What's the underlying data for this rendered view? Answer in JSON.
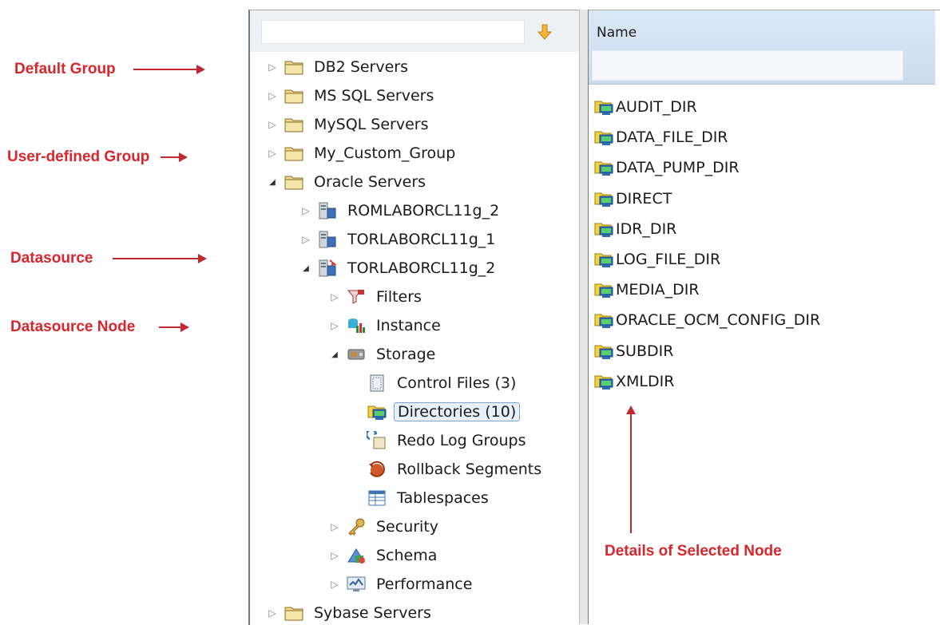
{
  "callouts": {
    "default_group": "Default Group",
    "user_defined_group": "User-defined Group",
    "datasource": "Datasource",
    "datasource_node": "Datasource Node",
    "details_of_selected_node": "Details of Selected Node"
  },
  "tree": {
    "search_placeholder": "",
    "items": [
      {
        "label": "DB2 Servers",
        "icon": "folder-icon"
      },
      {
        "label": "MS SQL Servers",
        "icon": "folder-icon"
      },
      {
        "label": "MySQL Servers",
        "icon": "folder-icon"
      },
      {
        "label": "My_Custom_Group",
        "icon": "folder-icon"
      },
      {
        "label": "Oracle Servers",
        "icon": "folder-icon"
      },
      {
        "label": "ROMLABORCL11g_2",
        "icon": "database-server-icon"
      },
      {
        "label": "TORLABORCL11g_1",
        "icon": "database-server-icon"
      },
      {
        "label": "TORLABORCL11g_2",
        "icon": "database-server-connected-icon"
      },
      {
        "label": "Filters",
        "icon": "filter-funnel-icon"
      },
      {
        "label": "Instance",
        "icon": "instance-icon"
      },
      {
        "label": "Storage",
        "icon": "storage-icon"
      },
      {
        "label": "Control Files (3)",
        "icon": "control-files-icon"
      },
      {
        "label": "Directories (10)",
        "icon": "directory-icon"
      },
      {
        "label": "Redo Log Groups",
        "icon": "redo-log-icon"
      },
      {
        "label": "Rollback Segments",
        "icon": "rollback-icon"
      },
      {
        "label": "Tablespaces",
        "icon": "tablespace-icon"
      },
      {
        "label": "Security",
        "icon": "key-icon"
      },
      {
        "label": "Schema",
        "icon": "schema-icon"
      },
      {
        "label": "Performance",
        "icon": "performance-monitor-icon"
      },
      {
        "label": "Sybase Servers",
        "icon": "folder-icon"
      }
    ]
  },
  "details": {
    "column_header": "Name",
    "filter_placeholder": "",
    "rows": [
      "AUDIT_DIR",
      "DATA_FILE_DIR",
      "DATA_PUMP_DIR",
      "DIRECT",
      "IDR_DIR",
      "LOG_FILE_DIR",
      "MEDIA_DIR",
      "ORACLE_OCM_CONFIG_DIR",
      "SUBDIR",
      "XMLDIR"
    ]
  },
  "colors": {
    "annotation": "#d8262c",
    "selection_border": "#7da2ce",
    "header_bg": "#d3e2f3"
  }
}
